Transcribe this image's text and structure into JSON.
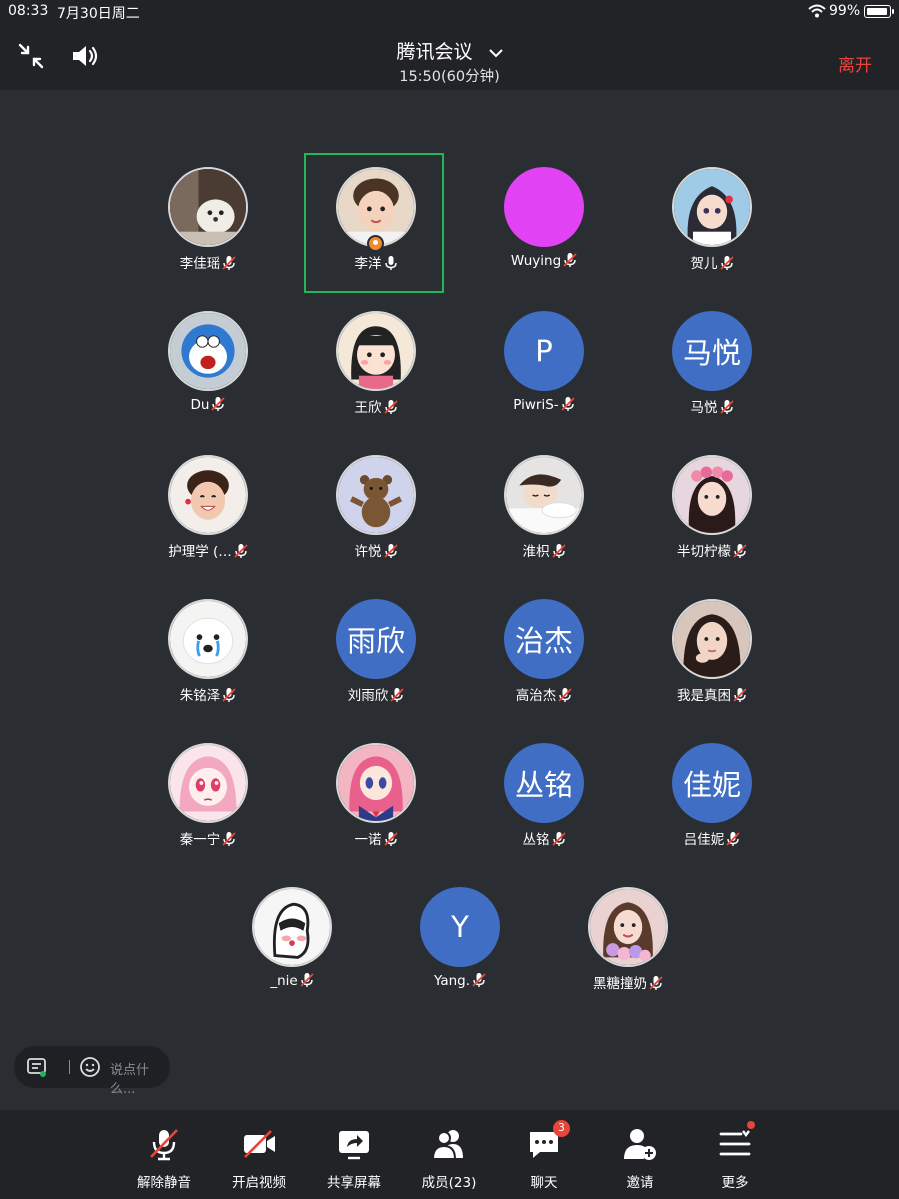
{
  "status_bar": {
    "time": "08:33",
    "date": "7月30日周二",
    "battery": "99%",
    "battery_level": 0.99
  },
  "header": {
    "title": "腾讯会议",
    "subtitle": "15:50(60分钟)",
    "leave_label": "离开",
    "icons": [
      "collapse-icon",
      "speaker-icon",
      "chevron-down-icon"
    ]
  },
  "participants": [
    {
      "name": "李佳瑶",
      "avatar": "photo-dog",
      "muted": true
    },
    {
      "name": "李洋",
      "avatar": "photo-child",
      "muted": false,
      "active_speaker": true,
      "host": true
    },
    {
      "name": "Wuying",
      "avatar": "solid-magenta",
      "muted": true
    },
    {
      "name": "贺儿",
      "avatar": "anime-girl",
      "muted": true
    },
    {
      "name": "Du",
      "avatar": "cartoon-doraemon",
      "muted": true
    },
    {
      "name": "王欣",
      "avatar": "cartoon-girl",
      "muted": true
    },
    {
      "name": "PiwriS-",
      "avatar_text": "P",
      "muted": true
    },
    {
      "name": "马悦",
      "avatar_text": "马悦",
      "muted": true
    },
    {
      "name": "护理学 (…",
      "avatar": "photo-child-smile",
      "muted": true
    },
    {
      "name": "许悦",
      "avatar": "cartoon-bear",
      "muted": true
    },
    {
      "name": "淮枳",
      "avatar": "photo-sleeping",
      "muted": true
    },
    {
      "name": "半切柠檬",
      "avatar": "photo-girl-flower",
      "muted": true
    },
    {
      "name": "朱铭泽",
      "avatar": "photo-white-dog",
      "muted": true
    },
    {
      "name": "刘雨欣",
      "avatar_text": "雨欣",
      "muted": true
    },
    {
      "name": "高治杰",
      "avatar_text": "治杰",
      "muted": true
    },
    {
      "name": "我是真困",
      "avatar": "photo-girl",
      "muted": true
    },
    {
      "name": "秦一宁",
      "avatar": "anime-pink",
      "muted": true
    },
    {
      "name": "一诺",
      "avatar": "anime-sailor",
      "muted": true
    },
    {
      "name": "丛铭",
      "avatar_text": "丛铭",
      "muted": true
    },
    {
      "name": "吕佳妮",
      "avatar_text": "佳妮",
      "muted": true
    },
    {
      "name": "_nie",
      "avatar": "cartoon-sketch",
      "muted": true
    },
    {
      "name": "Yang.",
      "avatar_text": "Y",
      "muted": true
    },
    {
      "name": "黑糖撞奶",
      "avatar": "photo-woman-flowers",
      "muted": true
    }
  ],
  "chat_input": {
    "placeholder": "说点什么..."
  },
  "toolbar": {
    "unmute": "解除静音",
    "video": "开启视频",
    "share": "共享屏幕",
    "members": "成员(23)",
    "chat": "聊天",
    "chat_badge": "3",
    "invite": "邀请",
    "more": "更多"
  },
  "colors": {
    "accent_red": "#e8453c",
    "active_green": "#23b55a",
    "avatar_blue": "#3f6ec4",
    "magenta": "#e142f3"
  }
}
